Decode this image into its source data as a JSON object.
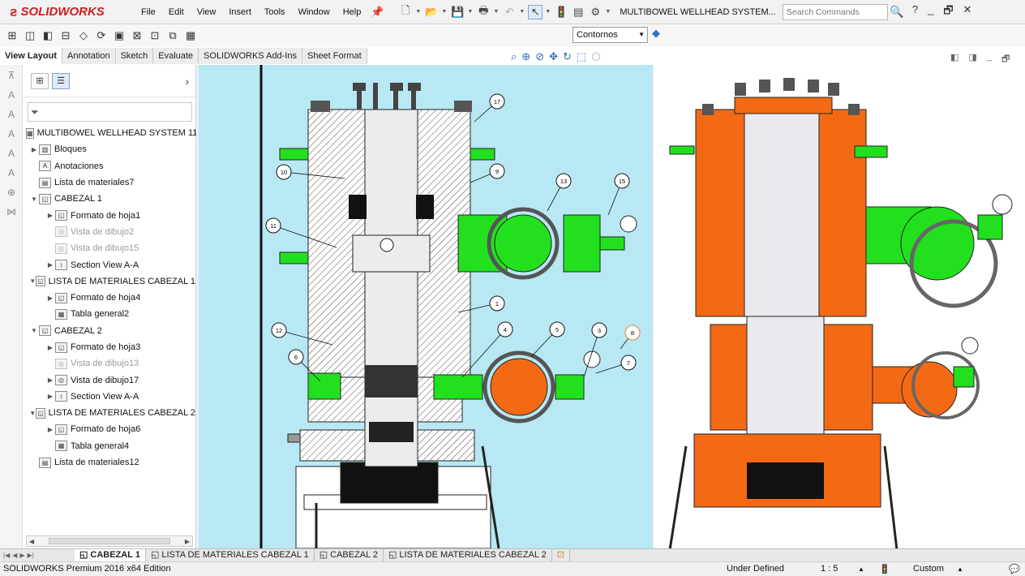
{
  "app": {
    "brand": "SOLIDWORKS",
    "document_title": "MULTIBOWEL WELLHEAD SYSTEM...",
    "search_placeholder": "Search Commands"
  },
  "menu": [
    "File",
    "Edit",
    "View",
    "Insert",
    "Tools",
    "Window",
    "Help"
  ],
  "toolbar": {
    "display_style": "Contornos"
  },
  "command_tabs": [
    "View Layout",
    "Annotation",
    "Sketch",
    "Evaluate",
    "SOLIDWORKS Add-Ins",
    "Sheet Format"
  ],
  "feature_tree": [
    {
      "label": "MULTIBOWEL WELLHEAD SYSTEM 11",
      "level": 0,
      "icon": "drawing-icon"
    },
    {
      "label": "Bloques",
      "level": 1,
      "icon": "blocks-icon"
    },
    {
      "label": "Anotaciones",
      "level": 1,
      "icon": "annotations-icon"
    },
    {
      "label": "Lista de materiales7",
      "level": 1,
      "icon": "bom-icon"
    },
    {
      "label": "CABEZAL 1",
      "level": 1,
      "icon": "sheet-icon"
    },
    {
      "label": "Formato de hoja1",
      "level": 2,
      "icon": "sheet-format-icon"
    },
    {
      "label": "Vista de dibujo2",
      "level": 2,
      "icon": "drawing-view-icon",
      "dim": true
    },
    {
      "label": "Vista de dibujo15",
      "level": 2,
      "icon": "drawing-view-icon",
      "dim": true
    },
    {
      "label": "Section View A-A",
      "level": 2,
      "icon": "section-view-icon"
    },
    {
      "label": "LISTA DE MATERIALES CABEZAL 1",
      "level": 1,
      "icon": "sheet-icon"
    },
    {
      "label": "Formato de hoja4",
      "level": 2,
      "icon": "sheet-format-icon"
    },
    {
      "label": "Tabla general2",
      "level": 2,
      "icon": "table-icon"
    },
    {
      "label": "CABEZAL 2",
      "level": 1,
      "icon": "sheet-icon"
    },
    {
      "label": "Formato de hoja3",
      "level": 2,
      "icon": "sheet-format-icon"
    },
    {
      "label": "Vista de dibujo13",
      "level": 2,
      "icon": "drawing-view-icon",
      "dim": true
    },
    {
      "label": "Vista de dibujo17",
      "level": 2,
      "icon": "drawing-view-icon"
    },
    {
      "label": "Section View A-A",
      "level": 2,
      "icon": "section-view-icon"
    },
    {
      "label": "LISTA DE MATERIALES CABEZAL 2",
      "level": 1,
      "icon": "sheet-icon"
    },
    {
      "label": "Formato de hoja6",
      "level": 2,
      "icon": "sheet-format-icon"
    },
    {
      "label": "Tabla general4",
      "level": 2,
      "icon": "table-icon"
    },
    {
      "label": "Lista de materiales12",
      "level": 1,
      "icon": "bom-icon"
    }
  ],
  "balloons": [
    "17",
    "9",
    "10",
    "13",
    "15",
    "11",
    "1",
    "12",
    "4",
    "5",
    "3",
    "8",
    "6",
    "7"
  ],
  "sheet_tabs": [
    "CABEZAL 1",
    "LISTA DE MATERIALES CABEZAL 1",
    "CABEZAL 2",
    "LISTA DE MATERIALES CABEZAL 2"
  ],
  "status": {
    "edition": "SOLIDWORKS Premium 2016 x64 Edition",
    "state": "Under Defined",
    "scale": "1 : 5",
    "units": "Custom"
  },
  "colors": {
    "sheet_background": "#b8e8f4",
    "valve_green": "#22e01e",
    "valve_orange": "#f46a14",
    "brand_red": "#cc1f1f"
  }
}
